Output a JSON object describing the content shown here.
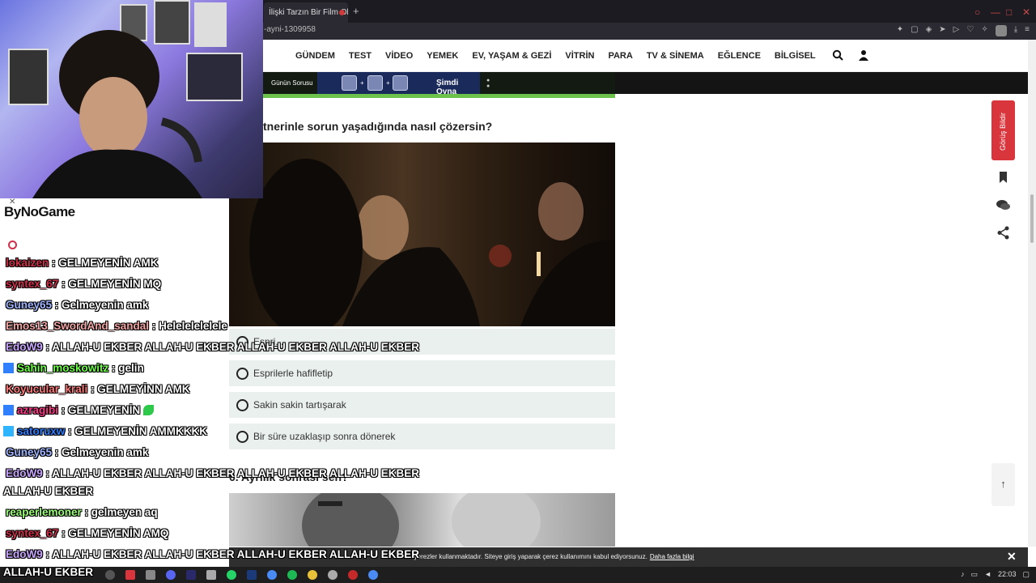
{
  "browser": {
    "tab_title": "İlişki Tarzın Bir Film Olsa,",
    "new_tab_symbol": "+",
    "url_fragment": "-ayni-1309958"
  },
  "site": {
    "nav": [
      "GÜNDEM",
      "TEST",
      "VİDEO",
      "YEMEK",
      "EV, YAŞAM & GEZİ",
      "VİTRİN",
      "PARA",
      "TV & SİNEMA",
      "EĞLENCE",
      "BİLGİSEL"
    ],
    "game_banner": {
      "question_label": "Günün Sorusu",
      "play_label": "Şimdi Oyna",
      "plus": "+"
    },
    "feedback_label": "Görüş Bildir",
    "scroll_top_symbol": "↑"
  },
  "content": {
    "question_title": "tnerinle sorun yaşadığında nasıl çözersin?",
    "options": [
      "Espri...",
      "Esprilerle hafifletip",
      "Sakin sakin tartışarak",
      "Bir süre uzaklaşıp sonra dönerek"
    ],
    "next_question": "6. Ayrılık sonrası sen?"
  },
  "cookie_bar": {
    "text": "...yerezler kullanmaktadır. Siteye giriş yaparak çerez kullanımını kabul ediyorsunuz.",
    "more_link": "Daha fazla bilgi",
    "close": "✕"
  },
  "taskbar": {
    "clock": "22:03"
  },
  "chat": {
    "logo": "ByNoGame",
    "close": "✕",
    "messages": [
      {
        "user": "lokaizen",
        "text": ": GELMEYENİN AMK",
        "color": "#d0304a"
      },
      {
        "user": "syntex_67",
        "text": ": GELMEYENİN MQ",
        "color": "#d0304a"
      },
      {
        "user": "Guney65",
        "text": ": Gelmeyenin amk",
        "color": "#9fb4ff"
      },
      {
        "user": "Emos13_SwordAnd_sandal",
        "text": ": Helelelelelele",
        "color": "#f4a6a6"
      },
      {
        "user": "EdoW9",
        "text": ": ALLAH-U EKBER ALLAH-U EKBER ALLAH-U EKBER ALLAH-U EKBER",
        "color": "#c9a6ff"
      },
      {
        "user": "Sahin_moskowitz",
        "text": ": gelin",
        "color": "#6fff4a"
      },
      {
        "user": "Koyucular_krali",
        "text": ": GELMEYİNN AMK",
        "color": "#ff7a7a"
      },
      {
        "user": "azragibi",
        "text": ": GELMEYENİN",
        "color": "#ff3a8a"
      },
      {
        "user": "satoruxw",
        "text": ": GELMEYENİN AMMKKKK",
        "color": "#2f7fff"
      },
      {
        "user": "Guney65",
        "text": ": Gelmeyenin amk",
        "color": "#9fb4ff"
      },
      {
        "user": "EdoW9",
        "text": ": ALLAH-U EKBER ALLAH-U EKBER ALLAH-U EKBER ALLAH-U EKBER",
        "color": "#c9a6ff"
      },
      {
        "user": "",
        "text": "ALLAH-U EKBER",
        "color": "#ffffff"
      },
      {
        "user": "reaperlemoner",
        "text": ": gelmeyen aq",
        "color": "#9cff7a"
      },
      {
        "user": "syntex_67",
        "text": ": GELMEYENİN AMQ",
        "color": "#d0304a"
      },
      {
        "user": "EdoW9",
        "text": ": ALLAH-U EKBER ALLAH-U EKBER ALLAH-U EKBER ALLAH-U EKBER",
        "color": "#c9a6ff"
      },
      {
        "user": "",
        "text": "ALLAH-U EKBER",
        "color": "#ffffff"
      }
    ]
  }
}
